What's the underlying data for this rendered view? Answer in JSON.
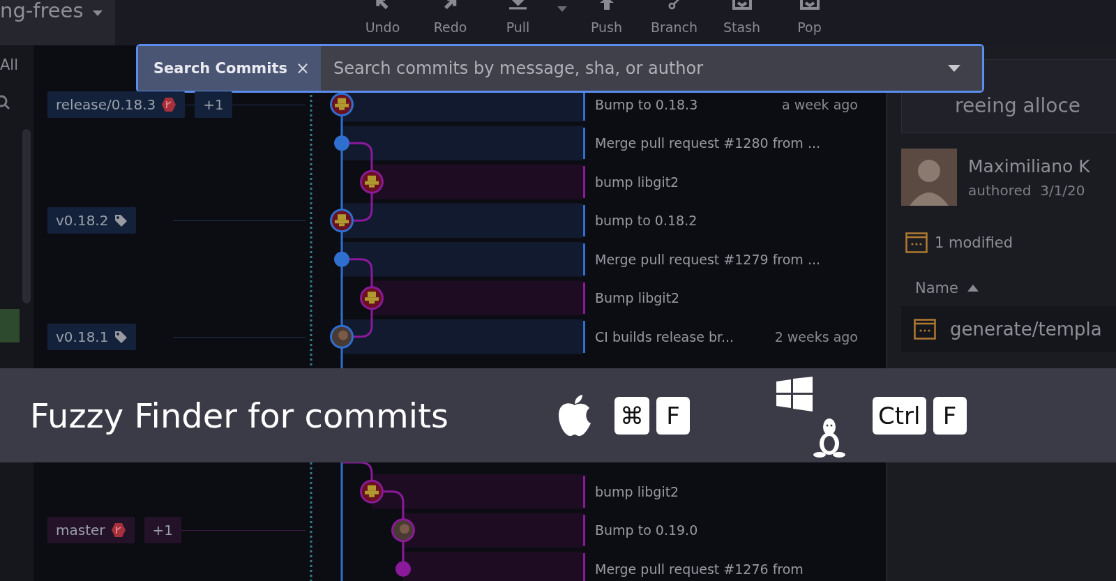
{
  "branch": {
    "name": "ng-frees"
  },
  "toolbar": [
    {
      "label": "Undo"
    },
    {
      "label": "Redo"
    },
    {
      "label": "Pull",
      "dropdown": true
    },
    {
      "label": "Push"
    },
    {
      "label": "Branch"
    },
    {
      "label": "Stash"
    },
    {
      "label": "Pop"
    }
  ],
  "rail": {
    "label": "All"
  },
  "search": {
    "label": "Search Commits",
    "close": "×",
    "placeholder": "Search commits by message, sha, or author"
  },
  "commits": [
    {
      "refs": [
        {
          "label": "release/0.18.3",
          "kind": "branch"
        }
      ],
      "extra": "+1",
      "kind": "pixel",
      "color": "#2f6fd0",
      "message": "Bump to 0.18.3",
      "time": "a week ago"
    },
    {
      "kind": "merge",
      "color": "#2f6fd0",
      "message": "Merge pull request #1280 from ..."
    },
    {
      "kind": "pixel",
      "color": "#8a1a9a",
      "message": "bump libgit2"
    },
    {
      "refs": [
        {
          "label": "v0.18.2",
          "kind": "tag"
        }
      ],
      "kind": "pixel",
      "color": "#2f6fd0",
      "message": "bump to 0.18.2"
    },
    {
      "kind": "merge",
      "color": "#2f6fd0",
      "message": "Merge pull request #1279 from ..."
    },
    {
      "kind": "pixel",
      "color": "#8a1a9a",
      "message": "Bump libgit2"
    },
    {
      "refs": [
        {
          "label": "v0.18.1",
          "kind": "tag"
        }
      ],
      "kind": "photo",
      "color": "#2f6fd0",
      "message": "CI builds release br...",
      "time": "2 weeks ago"
    },
    {
      "kind": "pixel",
      "color": "#8a1a9a",
      "message": "bump libgit2"
    },
    {
      "refs": [
        {
          "label": "master",
          "kind": "branch"
        }
      ],
      "extra": "+1",
      "kind": "photo",
      "color": "#8a1a9a",
      "message": "Bump to 0.19.0"
    },
    {
      "kind": "merge",
      "color": "#8a1a9a",
      "message": "Merge pull request #1276 from"
    }
  ],
  "details": {
    "title": "reeing alloce",
    "author": "Maximiliano K",
    "authored": "authored",
    "date": "3/1/20",
    "modified": "1 modified",
    "column": "Name",
    "files": [
      "generate/templa"
    ]
  },
  "banner": {
    "title": "Fuzzy Finder for commits",
    "mac_keys": [
      "⌘",
      "F"
    ],
    "other_keys": [
      "Ctrl",
      "F"
    ]
  }
}
